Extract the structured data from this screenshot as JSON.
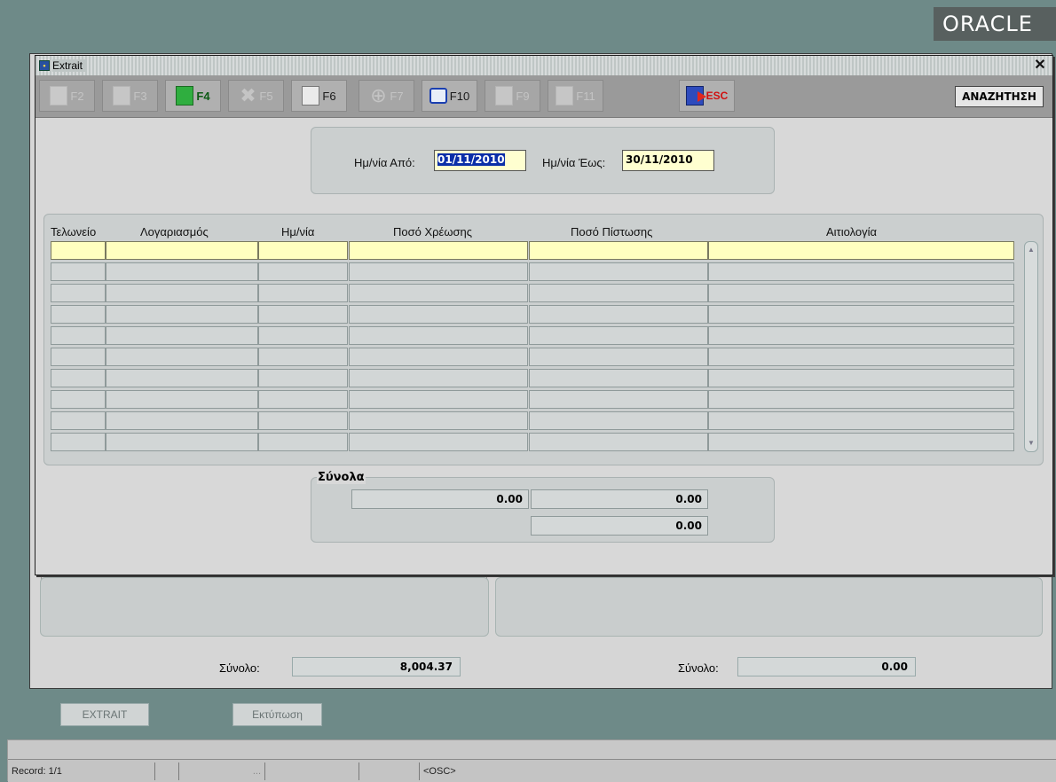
{
  "branding": {
    "logo_text": "ORACLE"
  },
  "window": {
    "title": "Extrait",
    "close_glyph": "✕"
  },
  "toolbar": {
    "buttons": [
      {
        "label": "F2",
        "icon": "save-icon",
        "enabled": false
      },
      {
        "label": "F3",
        "icon": "query-icon",
        "enabled": false
      },
      {
        "label": "F4",
        "icon": "execute-icon",
        "enabled": true
      },
      {
        "label": "F5",
        "icon": "delete-icon",
        "enabled": false
      },
      {
        "label": "F6",
        "icon": "new-record-icon",
        "enabled": true
      },
      {
        "label": "F7",
        "icon": "find-icon",
        "enabled": false
      },
      {
        "label": "F10",
        "icon": "print-icon",
        "enabled": true
      },
      {
        "label": "F9",
        "icon": "insert-icon",
        "enabled": false
      },
      {
        "label": "F11",
        "icon": "remove-icon",
        "enabled": false
      }
    ],
    "exit_label": "ESC",
    "search_label": "ΑΝΑΖΗΤΗΣΗ"
  },
  "date_filter": {
    "from_label": "Ημ/νία Από:",
    "from_value": "01/11/2010",
    "to_label": "Ημ/νία Έως:",
    "to_value": "30/11/2010"
  },
  "grid": {
    "columns": [
      "Τελωνείο",
      "Λογαριασμός",
      "Ημ/νία",
      "Ποσό Χρέωσης",
      "Ποσό Πίστωσης",
      "Αιτιολογία"
    ],
    "row_count": 10
  },
  "totals": {
    "legend": "Σύνολα",
    "debit_total": "0.00",
    "credit_total": "0.00",
    "balance": "0.00"
  },
  "background_form": {
    "left_total_label": "Σύνολο:",
    "left_total_value": "8,004.37",
    "right_total_label": "Σύνολο:",
    "right_total_value": "0.00",
    "extrait_button": "EXTRAIT",
    "print_button": "Εκτύπωση"
  },
  "status_bar": {
    "record": "Record: 1/1",
    "ellipsis": "...",
    "mode": "<OSC>"
  },
  "colors": {
    "desktop": "#6e8a88",
    "field_yellow": "#ffffc0",
    "selection": "#0a2ea8",
    "exit_red": "#d01010"
  }
}
